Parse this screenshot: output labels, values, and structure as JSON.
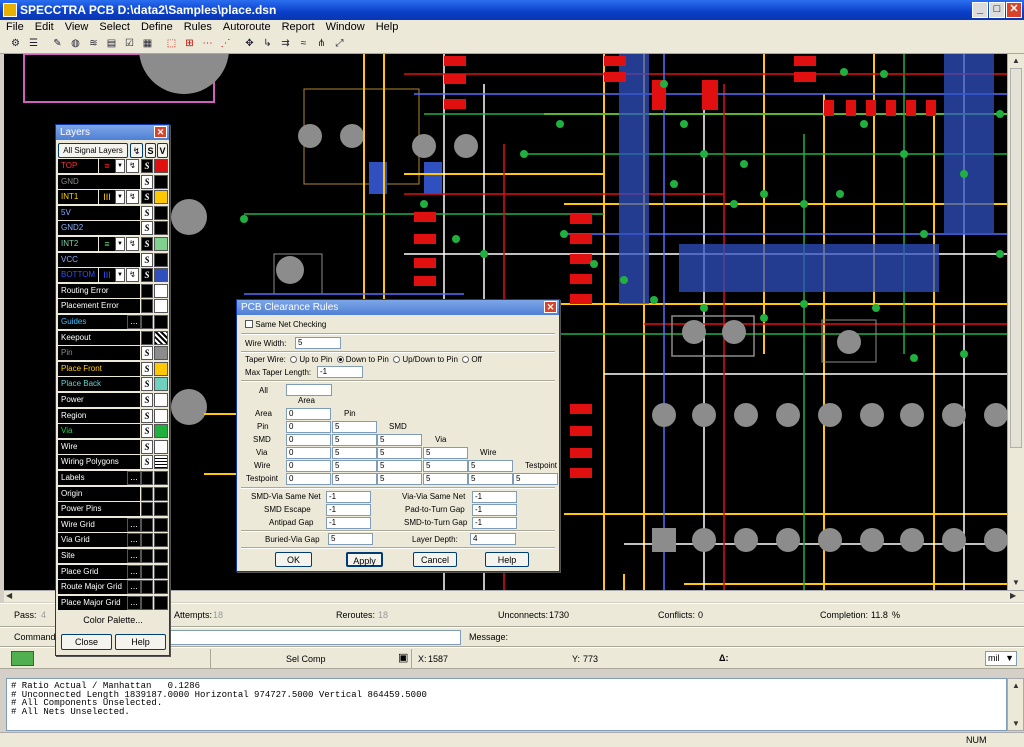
{
  "window": {
    "title": "SPECCTRA PCB D:\\data2\\Samples\\place.dsn",
    "minimize": "_",
    "maximize": "□",
    "close": "✕"
  },
  "menu": [
    "File",
    "Edit",
    "View",
    "Select",
    "Define",
    "Rules",
    "Autoroute",
    "Report",
    "Window",
    "Help"
  ],
  "layers_panel": {
    "title": "Layers",
    "all_signal": "All Signal Layers",
    "col_s": "S",
    "col_v": "V",
    "rows": [
      {
        "name": "TOP",
        "text_color": "#ff3030",
        "pattern": "≡",
        "pattern_color": "#ff2020",
        "dropdown": true,
        "s": "S",
        "color": "#e01010",
        "s_dark": true
      },
      {
        "name": "GND",
        "text_color": "#8c8c8c",
        "s": "S",
        "color": "#000000"
      },
      {
        "name": "INT1",
        "text_color": "#ffd000",
        "pattern": "III",
        "pattern_color": "#ffd000",
        "dropdown": true,
        "s": "S",
        "color": "#ffc800",
        "s_dark": true
      },
      {
        "name": "5V",
        "text_color": "#8ab0ff",
        "s": "S",
        "color": "#000000"
      },
      {
        "name": "GND2",
        "text_color": "#8ab0ff",
        "s": "S",
        "color": "#000000"
      },
      {
        "name": "INT2",
        "text_color": "#7ad0a0",
        "pattern": "≡",
        "pattern_color": "#60d080",
        "dropdown": true,
        "s": "S",
        "color": "#80d090",
        "s_dark": true
      },
      {
        "name": "VCC",
        "text_color": "#8ab0ff",
        "s": "S",
        "color": "#000000"
      },
      {
        "name": "BOTTOM",
        "text_color": "#3050ff",
        "pattern": "III",
        "pattern_color": "#3050ff",
        "dropdown": true,
        "s": "S",
        "color": "#3050c0",
        "s_dark": true
      },
      {
        "name": "Routing Error",
        "text_color": "#ffffff",
        "color": "#ffffff"
      },
      {
        "name": "Placement Error",
        "text_color": "#ffffff",
        "color": "#ffffff"
      },
      {
        "name": "Guides",
        "text_color": "#40c0ff",
        "dots": "...",
        "color": "#000000"
      },
      {
        "name": "Keepout",
        "text_color": "#ffffff",
        "color": "#ffffff",
        "hatch": true
      },
      {
        "name": "Pin",
        "text_color": "#8c8c8c",
        "s": "S",
        "color": "#8c8c8c"
      },
      {
        "name": "Place Front",
        "text_color": "#ffd000",
        "s": "S",
        "color": "#ffc800"
      },
      {
        "name": "Place Back",
        "text_color": "#60d0d0",
        "s": "S",
        "color": "#70d0c0"
      },
      {
        "name": "Power",
        "text_color": "#ffffff",
        "s": "S",
        "color": "#ffffff"
      },
      {
        "name": "Region",
        "text_color": "#ffffff",
        "s": "S",
        "color": "#ffffff"
      },
      {
        "name": "Via",
        "text_color": "#30d050",
        "s": "S",
        "color": "#20b040"
      },
      {
        "name": "Wire",
        "text_color": "#ffffff",
        "s": "S",
        "color": "#ffffff"
      },
      {
        "name": "Wiring Polygons",
        "text_color": "#ffffff",
        "s": "S",
        "color": "#ffffff",
        "grid": true
      },
      {
        "name": "Labels",
        "text_color": "#ffffff",
        "dots": "...",
        "color": "#000000"
      },
      {
        "name": "Origin",
        "text_color": "#ffffff",
        "color": "#000000"
      },
      {
        "name": "Power Pins",
        "text_color": "#ffffff",
        "color": "#000000"
      },
      {
        "name": "Wire Grid",
        "text_color": "#ffffff",
        "dots": "...",
        "color": "#000000"
      },
      {
        "name": "Via Grid",
        "text_color": "#ffffff",
        "dots": "...",
        "color": "#000000"
      },
      {
        "name": "Site",
        "text_color": "#ffffff",
        "dots": "...",
        "color": "#000000"
      },
      {
        "name": "Place Grid",
        "text_color": "#ffffff",
        "dots": "...",
        "color": "#000000"
      },
      {
        "name": "Route Major Grid",
        "text_color": "#ffffff",
        "dots": "...",
        "color": "#000000"
      },
      {
        "name": "Place Major Grid",
        "text_color": "#ffffff",
        "dots": "...",
        "color": "#000000"
      }
    ],
    "color_palette": "Color Palette...",
    "close": "Close",
    "help": "Help"
  },
  "clearance": {
    "title": "PCB Clearance Rules",
    "same_net": "Same Net Checking",
    "wire_width_label": "Wire Width:",
    "wire_width": "5",
    "taper_label": "Taper Wire:",
    "taper_options": [
      "Up to Pin",
      "Down to Pin",
      "Up/Down to Pin",
      "Off"
    ],
    "taper_selected": 1,
    "max_taper_label": "Max Taper Length:",
    "max_taper": "-1",
    "all_label": "All",
    "all_value": "",
    "col_headers": [
      "Area",
      "Pin",
      "SMD",
      "Via",
      "Wire",
      "Testpoint"
    ],
    "row_labels": [
      "Area",
      "Pin",
      "SMD",
      "Via",
      "Wire",
      "Testpoint"
    ],
    "matrix": [
      [
        "0"
      ],
      [
        "0",
        "5"
      ],
      [
        "0",
        "5",
        "5"
      ],
      [
        "0",
        "5",
        "5",
        "5"
      ],
      [
        "0",
        "5",
        "5",
        "5",
        "5"
      ],
      [
        "0",
        "5",
        "5",
        "5",
        "5",
        "5"
      ]
    ],
    "left_fields": [
      {
        "label": "SMD-Via Same Net",
        "value": "-1"
      },
      {
        "label": "SMD Escape",
        "value": "-1"
      },
      {
        "label": "Antipad Gap",
        "value": "-1"
      }
    ],
    "right_fields": [
      {
        "label": "Via-Via Same Net",
        "value": "-1"
      },
      {
        "label": "Pad-to-Turn Gap",
        "value": "-1"
      },
      {
        "label": "SMD-to-Turn Gap",
        "value": "-1"
      }
    ],
    "buried_label": "Buried-Via Gap",
    "buried_value": "5",
    "layer_depth_label": "Layer Depth:",
    "layer_depth_value": "4",
    "buttons": [
      "OK",
      "Apply",
      "Cancel",
      "Help"
    ]
  },
  "stats": {
    "pass_label": "Pass:",
    "pass_value": "4",
    "attempts_label": "Attempts:",
    "attempts_value": "18",
    "reroutes_label": "Reroutes:",
    "reroutes_value": "18",
    "unconnects_label": "Unconnects:",
    "unconnects_value": "1730",
    "conflicts_label": "Conflicts:",
    "conflicts_value": "0",
    "completion_label": "Completion:",
    "completion_value": "11.8",
    "completion_unit": "%"
  },
  "command": {
    "label": "Command",
    "value": "",
    "message_label": "Message:",
    "message_value": ""
  },
  "coords": {
    "mode": "Sel Comp",
    "x_label": "X:",
    "x_value": "1587",
    "y_label": "Y:",
    "y_value": "773",
    "delta_label": "Δ:",
    "units": "mil"
  },
  "console_lines": [
    "# Ratio Actual / Manhattan   0.1286",
    "# Unconnected Length 1839187.0000 Horizontal 974727.5000 Vertical 864459.5000",
    "# All Components Unselected.",
    "# All Nets Unselected."
  ],
  "statusbar": {
    "num": "NUM"
  },
  "colors": {
    "board": "#000000",
    "outline": "#ffc800",
    "top": "#e01010",
    "bottom": "#3050c0",
    "via": "#20b040",
    "pad": "#8c8c8c",
    "keepout": "#d060c0"
  }
}
